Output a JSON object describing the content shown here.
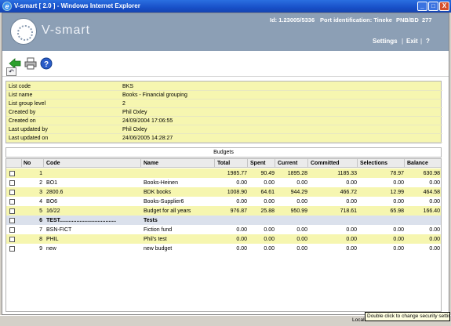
{
  "window": {
    "title": "V-smart [ 2.0 ] - Windows Internet Explorer",
    "minimize": "_",
    "maximize": "□",
    "close": "X"
  },
  "header": {
    "logo_text": "V-smart",
    "id_text": "Id: 1.23005/5336",
    "port_text": "Port identification: Tineke",
    "code_text": "PNB/BD",
    "number_text": "277",
    "settings": "Settings",
    "exit": "Exit",
    "help": "?"
  },
  "toolbar": {
    "back_icon": "back-arrow-icon",
    "print_icon": "print-icon",
    "help_icon": "help-icon"
  },
  "small_button": {
    "icon": "undo-icon",
    "glyph": "↶"
  },
  "info": [
    {
      "label": "List code",
      "value": "BKS"
    },
    {
      "label": "List name",
      "value": "Books - Financial grouping"
    },
    {
      "label": "List group level",
      "value": "2"
    },
    {
      "label": "Created by",
      "value": "Phil Oxley"
    },
    {
      "label": "Created on",
      "value": "24/09/2004 17:06:55"
    },
    {
      "label": "Last updated by",
      "value": "Phil Oxley"
    },
    {
      "label": "Last updated on",
      "value": "24/06/2005 14:28:27"
    }
  ],
  "budgets": {
    "title": "Budgets",
    "headers": [
      "No",
      "Code",
      "Name",
      "Total",
      "Spent",
      "Current",
      "Committed",
      "Selections",
      "Balance"
    ],
    "rows": [
      {
        "no": "1",
        "code": "",
        "name": "",
        "total": "1985.77",
        "spent": "90.49",
        "current": "1895.28",
        "committed": "1185.33",
        "selections": "78.97",
        "balance": "630.98",
        "style": "alt"
      },
      {
        "no": "2",
        "code": "BO1",
        "name": "Books-Heinen",
        "total": "0.00",
        "spent": "0.00",
        "current": "0.00",
        "committed": "0.00",
        "selections": "0.00",
        "balance": "0.00",
        "style": ""
      },
      {
        "no": "3",
        "code": "2800.6",
        "name": "BDK books",
        "total": "1008.90",
        "spent": "64.61",
        "current": "944.29",
        "committed": "466.72",
        "selections": "12.99",
        "balance": "464.58",
        "style": "alt"
      },
      {
        "no": "4",
        "code": "BO6",
        "name": "Books-Supplier6",
        "total": "0.00",
        "spent": "0.00",
        "current": "0.00",
        "committed": "0.00",
        "selections": "0.00",
        "balance": "0.00",
        "style": ""
      },
      {
        "no": "5",
        "code": "16/22",
        "name": "Budget for all years",
        "total": "976.87",
        "spent": "25.88",
        "current": "950.99",
        "committed": "718.61",
        "selections": "65.98",
        "balance": "166.40",
        "style": "alt"
      },
      {
        "no": "6",
        "code": "TEST.....................................",
        "name": "Tests",
        "total": "",
        "spent": "",
        "current": "",
        "committed": "",
        "selections": "",
        "balance": "",
        "style": "group"
      },
      {
        "no": "7",
        "code": "BSN-FICT",
        "name": "Fiction fund",
        "total": "0.00",
        "spent": "0.00",
        "current": "0.00",
        "committed": "0.00",
        "selections": "0.00",
        "balance": "0.00",
        "style": ""
      },
      {
        "no": "8",
        "code": "PHIL",
        "name": "Phil's test",
        "total": "0.00",
        "spent": "0.00",
        "current": "0.00",
        "committed": "0.00",
        "selections": "0.00",
        "balance": "0.00",
        "style": "alt"
      },
      {
        "no": "9",
        "code": "new",
        "name": "new budget",
        "total": "0.00",
        "spent": "0.00",
        "current": "0.00",
        "committed": "0.00",
        "selections": "0.00",
        "balance": "0.00",
        "style": ""
      }
    ]
  },
  "statusbar": {
    "zone_text": "Local",
    "tooltip": "Double click to change security settings"
  },
  "colors": {
    "header": "#8c9fb5",
    "info_bg": "#f6f6b0",
    "group_row": "#dbe1ec"
  }
}
